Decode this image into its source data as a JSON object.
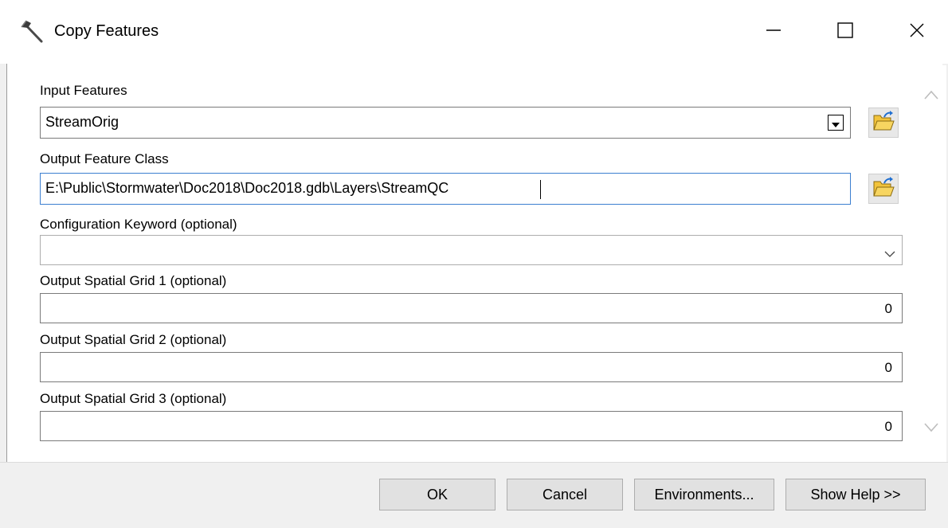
{
  "window": {
    "title": "Copy Features",
    "icon": "hammer-icon",
    "controls": {
      "minimize": "minimize-icon",
      "maximize": "maximize-icon",
      "close": "close-icon"
    }
  },
  "form": {
    "input_features": {
      "label": "Input Features",
      "value": "StreamOrig"
    },
    "output_feature_class": {
      "label": "Output Feature Class",
      "value": "E:\\Public\\Stormwater\\Doc2018\\Doc2018.gdb\\Layers\\StreamQC"
    },
    "config_keyword": {
      "label": "Configuration Keyword (optional)",
      "value": ""
    },
    "grid1": {
      "label": "Output Spatial Grid 1 (optional)",
      "value": "0"
    },
    "grid2": {
      "label": "Output Spatial Grid 2 (optional)",
      "value": "0"
    },
    "grid3": {
      "label": "Output Spatial Grid 3 (optional)",
      "value": "0"
    }
  },
  "buttons": {
    "ok": "OK",
    "cancel": "Cancel",
    "environments": "Environments...",
    "show_help": "Show Help >>"
  },
  "colors": {
    "folder_yellow": "#f2c33a",
    "folder_arrow": "#1f6fd1"
  }
}
